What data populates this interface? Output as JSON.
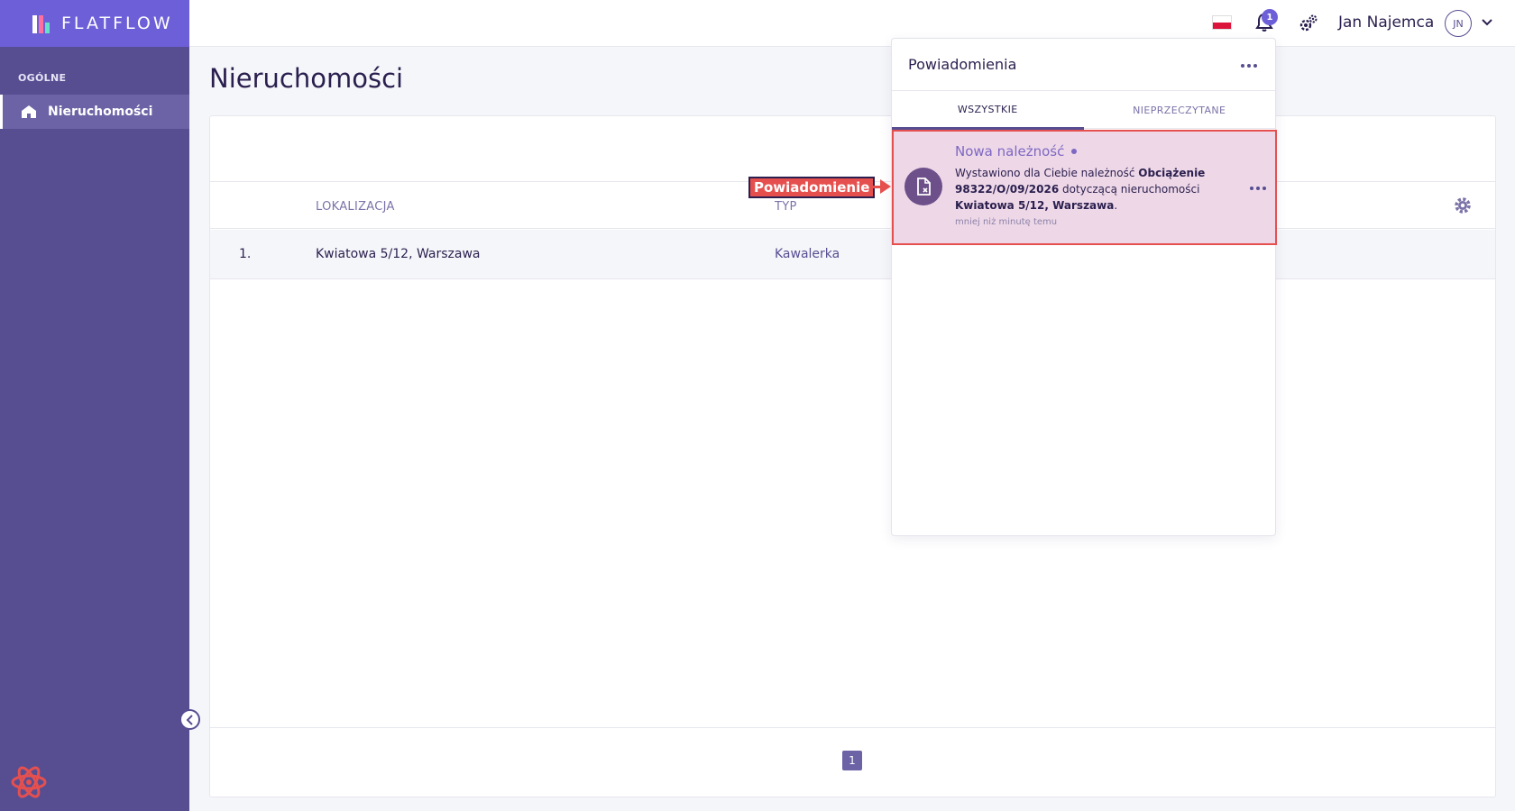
{
  "brand": {
    "name": "FLATFLOW"
  },
  "sidebar": {
    "section": "OGÓLNE",
    "items": [
      {
        "label": "Nieruchomości",
        "icon": "home-icon",
        "active": true
      }
    ]
  },
  "header": {
    "language_flag": "pl-flag-icon",
    "notification_count": "1",
    "user_name": "Jan Najemca",
    "user_initials": "JN"
  },
  "main": {
    "title": "Nieruchomości",
    "table": {
      "columns": [
        "LOKALIZACJA",
        "TYP"
      ],
      "rows": [
        {
          "index": "1.",
          "location": "Kwiatowa 5/12, Warszawa",
          "type": "Kawalerka"
        }
      ]
    },
    "pagination": {
      "current": "1"
    }
  },
  "notifications": {
    "title": "Powiadomienia",
    "tabs": [
      {
        "label": "WSZYSTKIE",
        "active": true
      },
      {
        "label": "NIEPRZECZYTANE",
        "active": false
      }
    ],
    "items": [
      {
        "title": "Nowa należność",
        "text_prefix": "Wystawiono dla Ciebie należność ",
        "charge": "Obciążenie 98322/O/09/2026",
        "text_mid": " dotyczącą nieruchomości ",
        "property": "Kwiatowa 5/12, Warszawa",
        "text_suffix": ".",
        "time": "mniej niż minutę temu"
      }
    ]
  },
  "annotation": {
    "label": "Powiadomienie",
    "color": "#e5504f"
  },
  "colors": {
    "sidebar": "#574e92",
    "brand": "#6d5fd8",
    "accent": "#7d68c2"
  }
}
